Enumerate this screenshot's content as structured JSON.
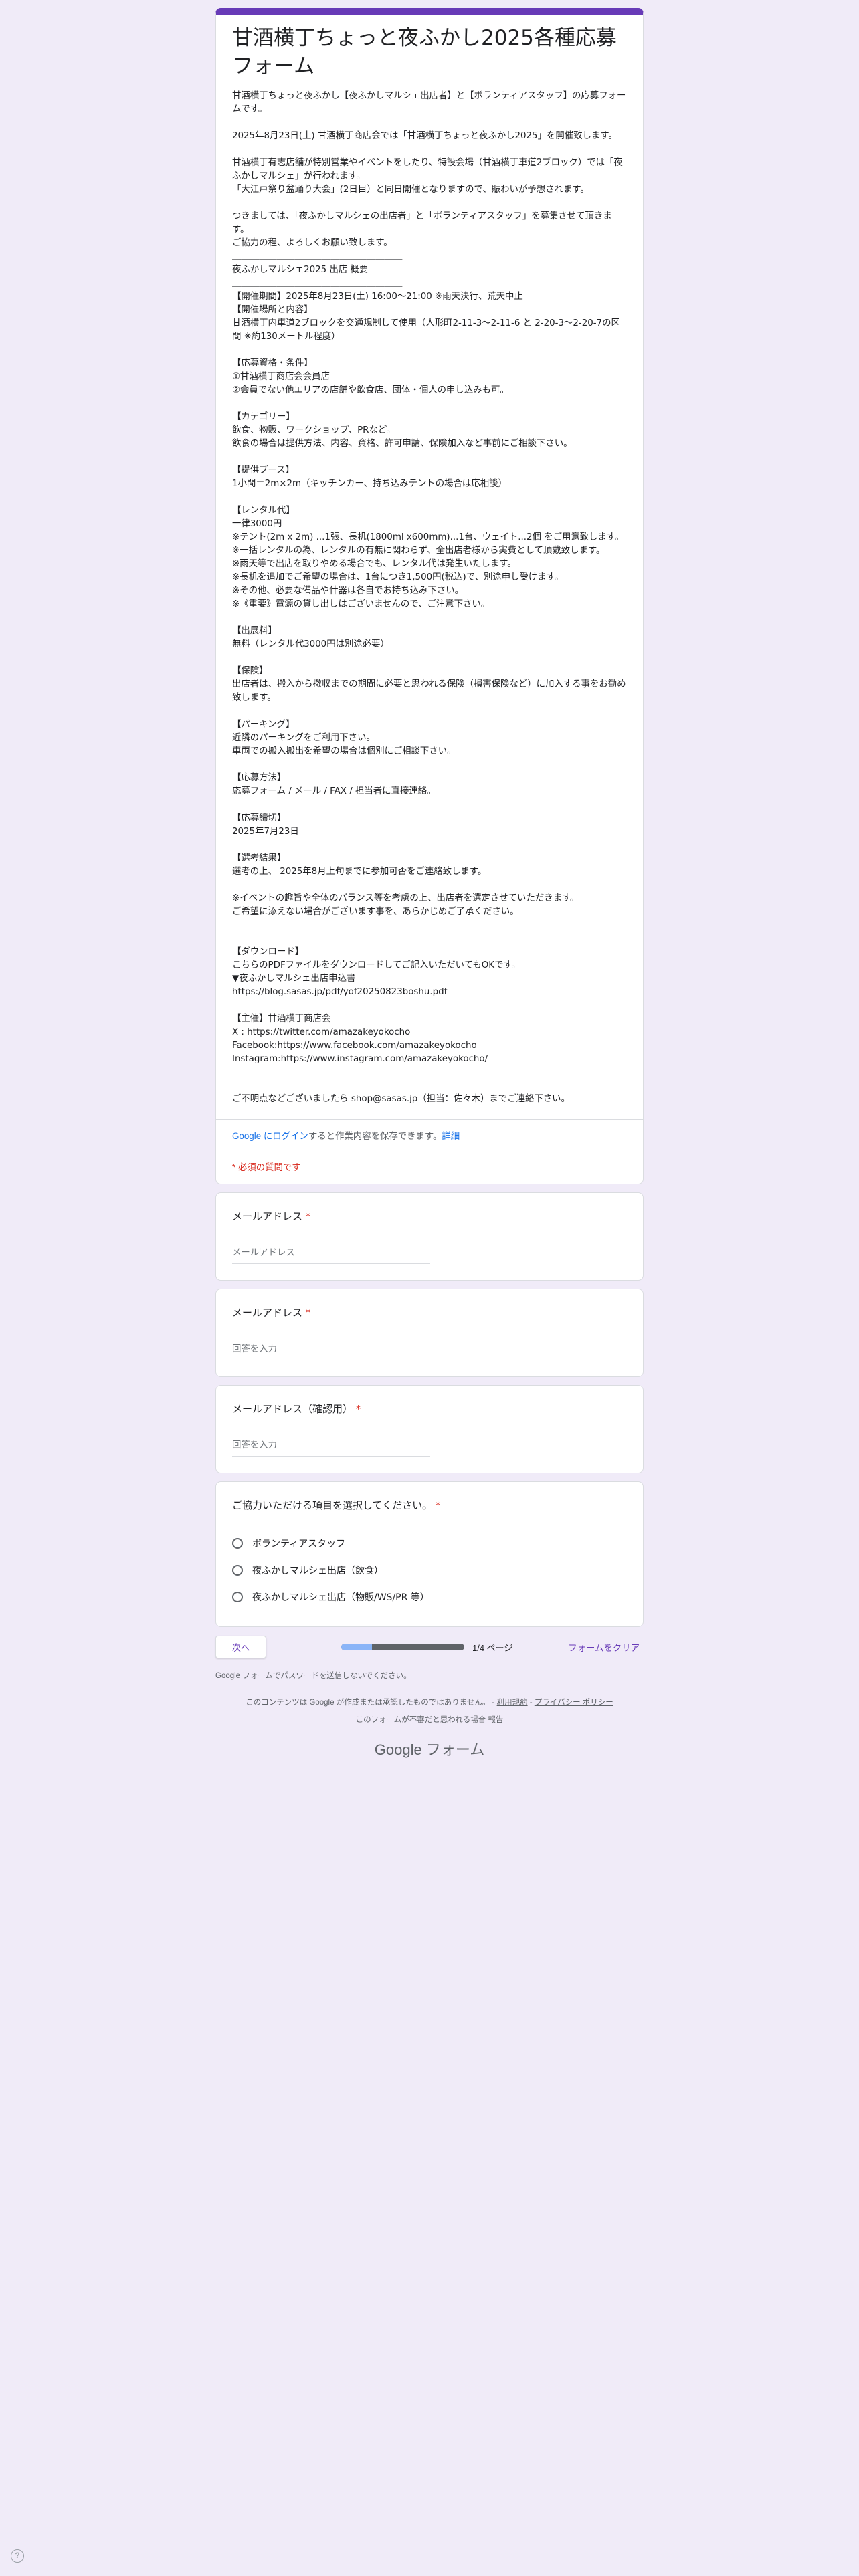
{
  "form": {
    "title": "甘酒横丁ちょっと夜ふかし2025各種応募フォーム",
    "description": "甘酒横丁ちょっと夜ふかし【夜ふかしマルシェ出店者】と【ボランティアスタッフ】の応募フォームです。\n\n2025年8月23日(土) 甘酒横丁商店会では「甘酒横丁ちょっと夜ふかし2025」を開催致します。\n\n甘酒横丁有志店舗が特別営業やイベントをしたり、特設会場（甘酒横丁車道2ブロック）では「夜ふかしマルシェ」が行われます。\n「大江戸祭り盆踊り大会」(2日目）と同日開催となりますので、賑わいが予想されます。\n\nつきましては、「夜ふかしマルシェの出店者」と「ボランティアスタッフ」を募集させて頂きます。\nご協力の程、よろしくお願い致します。\n＿＿＿＿＿＿＿＿＿＿＿＿＿＿＿＿＿＿＿\n夜ふかしマルシェ2025 出店 概要\n＿＿＿＿＿＿＿＿＿＿＿＿＿＿＿＿＿＿＿\n【開催期間】2025年8月23日(土) 16:00〜21:00 ※雨天決行、荒天中止\n【開催場所と内容】\n甘酒横丁内車道2ブロックを交通規制して使用（人形町2-11-3〜2-11-6 と 2-20-3〜2-20-7の区間 ※約130メートル程度）\n\n【応募資格・条件】\n①甘酒横丁商店会会員店\n②会員でない他エリアの店舗や飲食店、団体・個人の申し込みも可。\n\n【カテゴリー】\n飲食、物販、ワークショップ、PRなど。\n飲食の場合は提供方法、内容、資格、許可申請、保険加入など事前にご相談下さい。\n\n【提供ブース】\n1小間＝2m×2m（キッチンカー、持ち込みテントの場合は応相談）\n\n【レンタル代】\n一律3000円\n※テント(2m x 2m) ...1張、長机(1800ml x600mm)...1台、ウェイト...2個 をご用意致します。\n※一括レンタルの為、レンタルの有無に関わらず、全出店者様から実費として頂戴致します。\n※雨天等で出店を取りやめる場合でも、レンタル代は発生いたします。\n※長机を追加でご希望の場合は、1台につき1,500円(税込)で、別途申し受けます。\n※その他、必要な備品や什器は各自でお持ち込み下さい。\n※《重要》電源の貸し出しはございませんので、ご注意下さい。\n\n【出展料】\n無料（レンタル代3000円は別途必要）\n\n【保険】\n出店者は、搬入から撤収までの期間に必要と思われる保険（損害保険など）に加入する事をお勧め致します。\n\n【パーキング】\n近隣のパーキングをご利用下さい。\n車両での搬入搬出を希望の場合は個別にご相談下さい。\n\n【応募方法】\n応募フォーム / メール / FAX / 担当者に直接連絡。\n\n【応募締切】\n2025年7月23日\n\n【選考結果】\n選考の上、 2025年8月上旬までに参加可否をご連絡致します。\n\n※イベントの趣旨や全体のバランス等を考慮の上、出店者を選定させていただきます。\nご希望に添えない場合がございます事を、あらかじめご了承ください。\n\n\n【ダウンロード】\nこちらのPDFファイルをダウンロードしてご記入いただいてもOKです。\n▼夜ふかしマルシェ出店申込書\nhttps://blog.sasas.jp/pdf/yof20250823boshu.pdf\n\n【主催】甘酒横丁商店会\nX : https://twitter.com/amazakeyokocho\nFacebook:https://www.facebook.com/amazakeyokocho\nInstagram:https://www.instagram.com/amazakeyokocho/\n\n\nご不明点などございましたら shop@sasas.jp（担当：佐々木）までご連絡下さい。",
    "login_link": "Google にログイン",
    "login_text": "すると作業内容を保存できます。",
    "details_link": "詳細",
    "required_note": "* 必須の質問です"
  },
  "questions": [
    {
      "title": "メールアドレス",
      "required": "*",
      "placeholder": "メールアドレス"
    },
    {
      "title": "メールアドレス",
      "required": "*",
      "placeholder": "回答を入力"
    },
    {
      "title": "メールアドレス（確認用）",
      "required": "*",
      "placeholder": "回答を入力"
    }
  ],
  "choice_question": {
    "title": "ご協力いただける項目を選択してください。",
    "required": "*",
    "options": [
      "ボランティアスタッフ",
      "夜ふかしマルシェ出店（飲食）",
      "夜ふかしマルシェ出店（物販/WS/PR 等）"
    ]
  },
  "navigation": {
    "next_label": "次へ",
    "progress_text": "1/4 ページ",
    "progress_fraction": 0.25,
    "clear_label": "フォームをクリア"
  },
  "footer": {
    "password_note": "Google フォームでパスワードを送信しないでください。",
    "disclaimer": "このコンテンツは Google が作成または承認したものではありません。 - ",
    "terms_link": "利用規約",
    "separator": " - ",
    "privacy_link": "プライバシー ポリシー",
    "report_text": "このフォームが不審だと思われる場合 ",
    "report_link": "報告",
    "logo_google": "Google",
    "logo_forms": "フォーム"
  },
  "colors": {
    "accent": "#673ab7",
    "background": "#f0ebf8",
    "required": "#d93025",
    "link": "#1a73e8"
  },
  "icons": {
    "help": "help-circle-icon"
  }
}
